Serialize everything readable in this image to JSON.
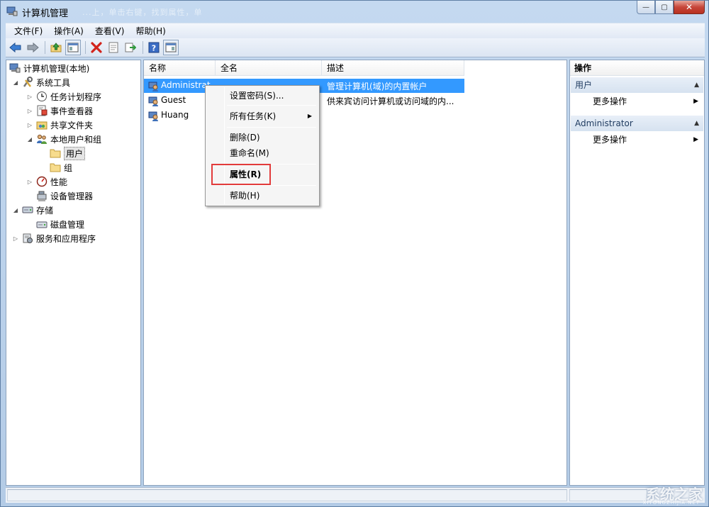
{
  "window": {
    "title": "计算机管理",
    "title_ghost": "...上，单击右键，找到属性，单",
    "controls": {
      "minimize": "—",
      "maximize": "▢",
      "close": "✕"
    }
  },
  "menubar": [
    "文件(F)",
    "操作(A)",
    "查看(V)",
    "帮助(H)"
  ],
  "toolbar": {
    "icons": [
      "back-arrow-icon",
      "forward-arrow-icon",
      "up-folder-icon",
      "show-hide-tree-icon",
      "delete-icon",
      "properties-icon",
      "export-icon",
      "help-icon",
      "show-hide-action-icon"
    ]
  },
  "tree": {
    "items": [
      {
        "label": "计算机管理(本地)",
        "toggle": "",
        "icon": "computer-management-icon"
      },
      {
        "label": "系统工具",
        "toggle": "◢",
        "icon": "tools-icon"
      },
      {
        "label": "任务计划程序",
        "toggle": "▷",
        "icon": "clock-icon"
      },
      {
        "label": "事件查看器",
        "toggle": "▷",
        "icon": "event-viewer-icon"
      },
      {
        "label": "共享文件夹",
        "toggle": "▷",
        "icon": "shared-folder-icon"
      },
      {
        "label": "本地用户和组",
        "toggle": "◢",
        "icon": "users-group-icon"
      },
      {
        "label": "用户",
        "toggle": "",
        "icon": "folder-icon"
      },
      {
        "label": "组",
        "toggle": "",
        "icon": "folder-icon"
      },
      {
        "label": "性能",
        "toggle": "▷",
        "icon": "performance-icon"
      },
      {
        "label": "设备管理器",
        "toggle": "",
        "icon": "device-manager-icon"
      },
      {
        "label": "存储",
        "toggle": "◢",
        "icon": "storage-icon"
      },
      {
        "label": "磁盘管理",
        "toggle": "",
        "icon": "disk-icon"
      },
      {
        "label": "服务和应用程序",
        "toggle": "▷",
        "icon": "services-icon"
      }
    ]
  },
  "list": {
    "columns": [
      "名称",
      "全名",
      "描述"
    ],
    "rows": [
      {
        "name": "Administrat",
        "fullname": "",
        "desc": "管理计算机(域)的内置帐户"
      },
      {
        "name": "Guest",
        "fullname": "",
        "desc": "供来宾访问计算机或访问域的内..."
      },
      {
        "name": "Huang",
        "fullname": "",
        "desc": ""
      }
    ]
  },
  "context_menu": {
    "set_password": "设置密码(S)...",
    "all_tasks": "所有任务(K)",
    "delete": "删除(D)",
    "rename": "重命名(M)",
    "properties": "属性(R)",
    "help": "帮助(H)",
    "submenu_arrow": "▶"
  },
  "actions": {
    "title": "操作",
    "sections": [
      {
        "name": "用户",
        "item": "更多操作"
      },
      {
        "name": "Administrator",
        "item": "更多操作"
      }
    ],
    "collapse_caret": "▲",
    "more_caret": "▶"
  },
  "watermark": {
    "text": "系统之家",
    "sub": "XITONGZHIJIA.NET"
  },
  "colors": {
    "selection": "#3399ff",
    "highlight_box": "#e23b3b"
  }
}
